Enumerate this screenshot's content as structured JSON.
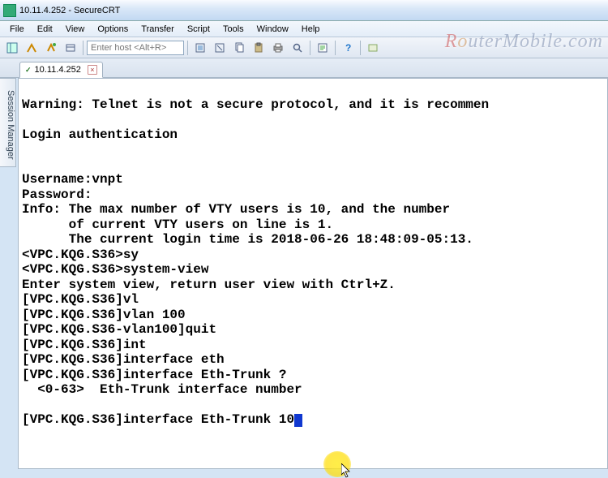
{
  "window": {
    "title": "10.11.4.252 - SecureCRT"
  },
  "menu": {
    "items": [
      "File",
      "Edit",
      "View",
      "Options",
      "Transfer",
      "Script",
      "Tools",
      "Window",
      "Help"
    ]
  },
  "toolbar": {
    "host_placeholder": "Enter host <Alt+R>"
  },
  "tab": {
    "label": "10.11.4.252"
  },
  "sidebar": {
    "label": "Session Manager"
  },
  "terminal": {
    "lines": [
      "",
      "Warning: Telnet is not a secure protocol, and it is recommen",
      "",
      "Login authentication",
      "",
      "",
      "Username:vnpt",
      "Password:",
      "Info: The max number of VTY users is 10, and the number",
      "      of current VTY users on line is 1.",
      "      The current login time is 2018-06-26 18:48:09-05:13.",
      "<VPC.KQG.S36>sy",
      "<VPC.KQG.S36>system-view",
      "Enter system view, return user view with Ctrl+Z.",
      "[VPC.KQG.S36]vl",
      "[VPC.KQG.S36]vlan 100",
      "[VPC.KQG.S36-vlan100]quit",
      "[VPC.KQG.S36]int",
      "[VPC.KQG.S36]interface eth",
      "[VPC.KQG.S36]interface Eth-Trunk ?",
      "  <0-63>  Eth-Trunk interface number",
      ""
    ],
    "prompt_line": "[VPC.KQG.S36]interface Eth-Trunk 10"
  },
  "watermark": {
    "text1": "R",
    "text2": "o",
    "text3": "uterMobile.com"
  }
}
